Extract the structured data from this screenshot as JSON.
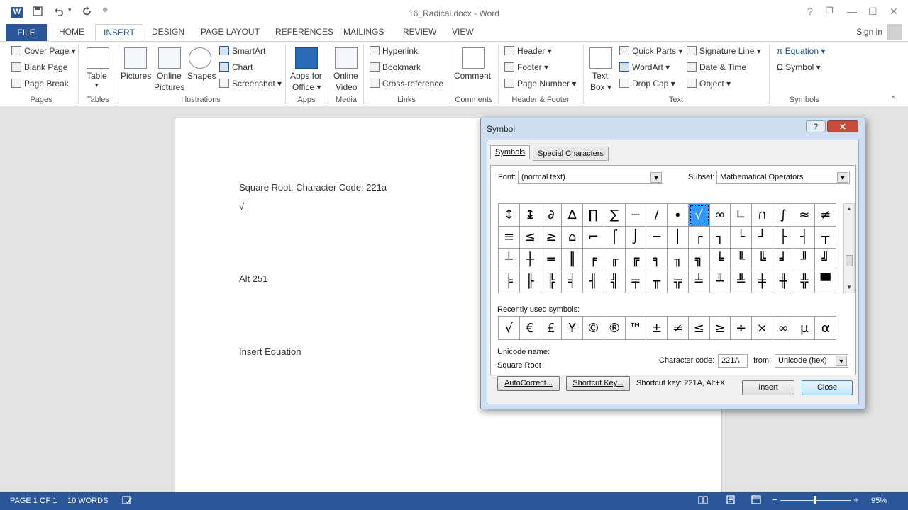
{
  "window": {
    "title": "16_Radical.docx - Word",
    "app_icon": "W",
    "help": "?",
    "restore": "❐",
    "minimize": "—",
    "maximize": "☐",
    "close": "✕"
  },
  "qat": {
    "save_icon": "save-icon",
    "undo_icon": "undo-icon",
    "redo_icon": "redo-icon"
  },
  "tabs": [
    "FILE",
    "HOME",
    "INSERT",
    "DESIGN",
    "PAGE LAYOUT",
    "REFERENCES",
    "MAILINGS",
    "REVIEW",
    "VIEW"
  ],
  "signin": "Sign in",
  "ribbon": {
    "pages": {
      "cover": "Cover Page ▾",
      "blank": "Blank Page",
      "break": "Page Break",
      "label": "Pages"
    },
    "tables": {
      "table": "Table",
      "label": "Tables"
    },
    "illustrations": {
      "pictures": "Pictures",
      "online1": "Online",
      "online2": "Pictures",
      "shapes": "Shapes",
      "smartart": "SmartArt",
      "chart": "Chart",
      "screenshot": "Screenshot ▾",
      "label": "Illustrations"
    },
    "apps": {
      "apps1": "Apps for",
      "apps2": "Office ▾",
      "label": "Apps"
    },
    "media": {
      "video1": "Online",
      "video2": "Video",
      "label": "Media"
    },
    "links": {
      "hyperlink": "Hyperlink",
      "bookmark": "Bookmark",
      "crossref": "Cross-reference",
      "label": "Links"
    },
    "comments": {
      "comment": "Comment",
      "label": "Comments"
    },
    "headerfooter": {
      "header": "Header ▾",
      "footer": "Footer ▾",
      "pagenumber": "Page Number ▾",
      "label": "Header & Footer"
    },
    "text": {
      "textbox1": "Text",
      "textbox2": "Box ▾",
      "quickparts": "Quick Parts ▾",
      "wordart": "WordArt ▾",
      "dropcap": "Drop Cap ▾",
      "sigline": "Signature Line ▾",
      "datetime": "Date & Time",
      "object": "Object ▾",
      "label": "Text"
    },
    "symbols": {
      "equation": "π  Equation ▾",
      "symbol": "Ω  Symbol ▾",
      "label": "Symbols"
    }
  },
  "document": {
    "line1": "Square Root: Character Code: 221a",
    "line2": "√",
    "line3": "Alt 251",
    "line4": "Insert Equation"
  },
  "statusbar": {
    "page": "PAGE 1 OF 1",
    "words": "10 WORDS",
    "zoom": "95%",
    "zoom_minus": "−",
    "zoom_plus": "+"
  },
  "dialog": {
    "title": "Symbol",
    "tab_symbols": "Symbols",
    "tab_special": "Special Characters",
    "font_label": "Font:",
    "font_value": "(normal text)",
    "subset_label": "Subset:",
    "subset_value": "Mathematical Operators",
    "grid": [
      "↕",
      "↨",
      "∂",
      "∆",
      "∏",
      "∑",
      "−",
      "∕",
      "∙",
      "√",
      "∞",
      "∟",
      "∩",
      "∫",
      "≈",
      "≠",
      "≡",
      "≤",
      "≥",
      "⌂",
      "⌐",
      "⌠",
      "⌡",
      "─",
      "│",
      "┌",
      "┐",
      "└",
      "┘",
      "├",
      "┤",
      "┬",
      "┴",
      "┼",
      "═",
      "║",
      "╒",
      "╓",
      "╔",
      "╕",
      "╖",
      "╗",
      "╘",
      "╙",
      "╚",
      "╛",
      "╜",
      "╝",
      "╞",
      "╟",
      "╠",
      "╡",
      "╢",
      "╣",
      "╤",
      "╥",
      "╦",
      "╧",
      "╨",
      "╩",
      "╪",
      "╫",
      "╬",
      "▀"
    ],
    "selected_index": 9,
    "recent_label": "Recently used symbols:",
    "recent": [
      "√",
      "€",
      "£",
      "¥",
      "©",
      "®",
      "™",
      "±",
      "≠",
      "≤",
      "≥",
      "÷",
      "×",
      "∞",
      "µ",
      "α"
    ],
    "unicode_name_label": "Unicode name:",
    "unicode_name": "Square Root",
    "charcode_label": "Character code:",
    "charcode": "221A",
    "from_label": "from:",
    "from_value": "Unicode (hex)",
    "autocorrect": "AutoCorrect...",
    "shortcutkey": "Shortcut Key...",
    "shortcut_text": "Shortcut key: 221A, Alt+X",
    "insert": "Insert",
    "close": "Close"
  }
}
